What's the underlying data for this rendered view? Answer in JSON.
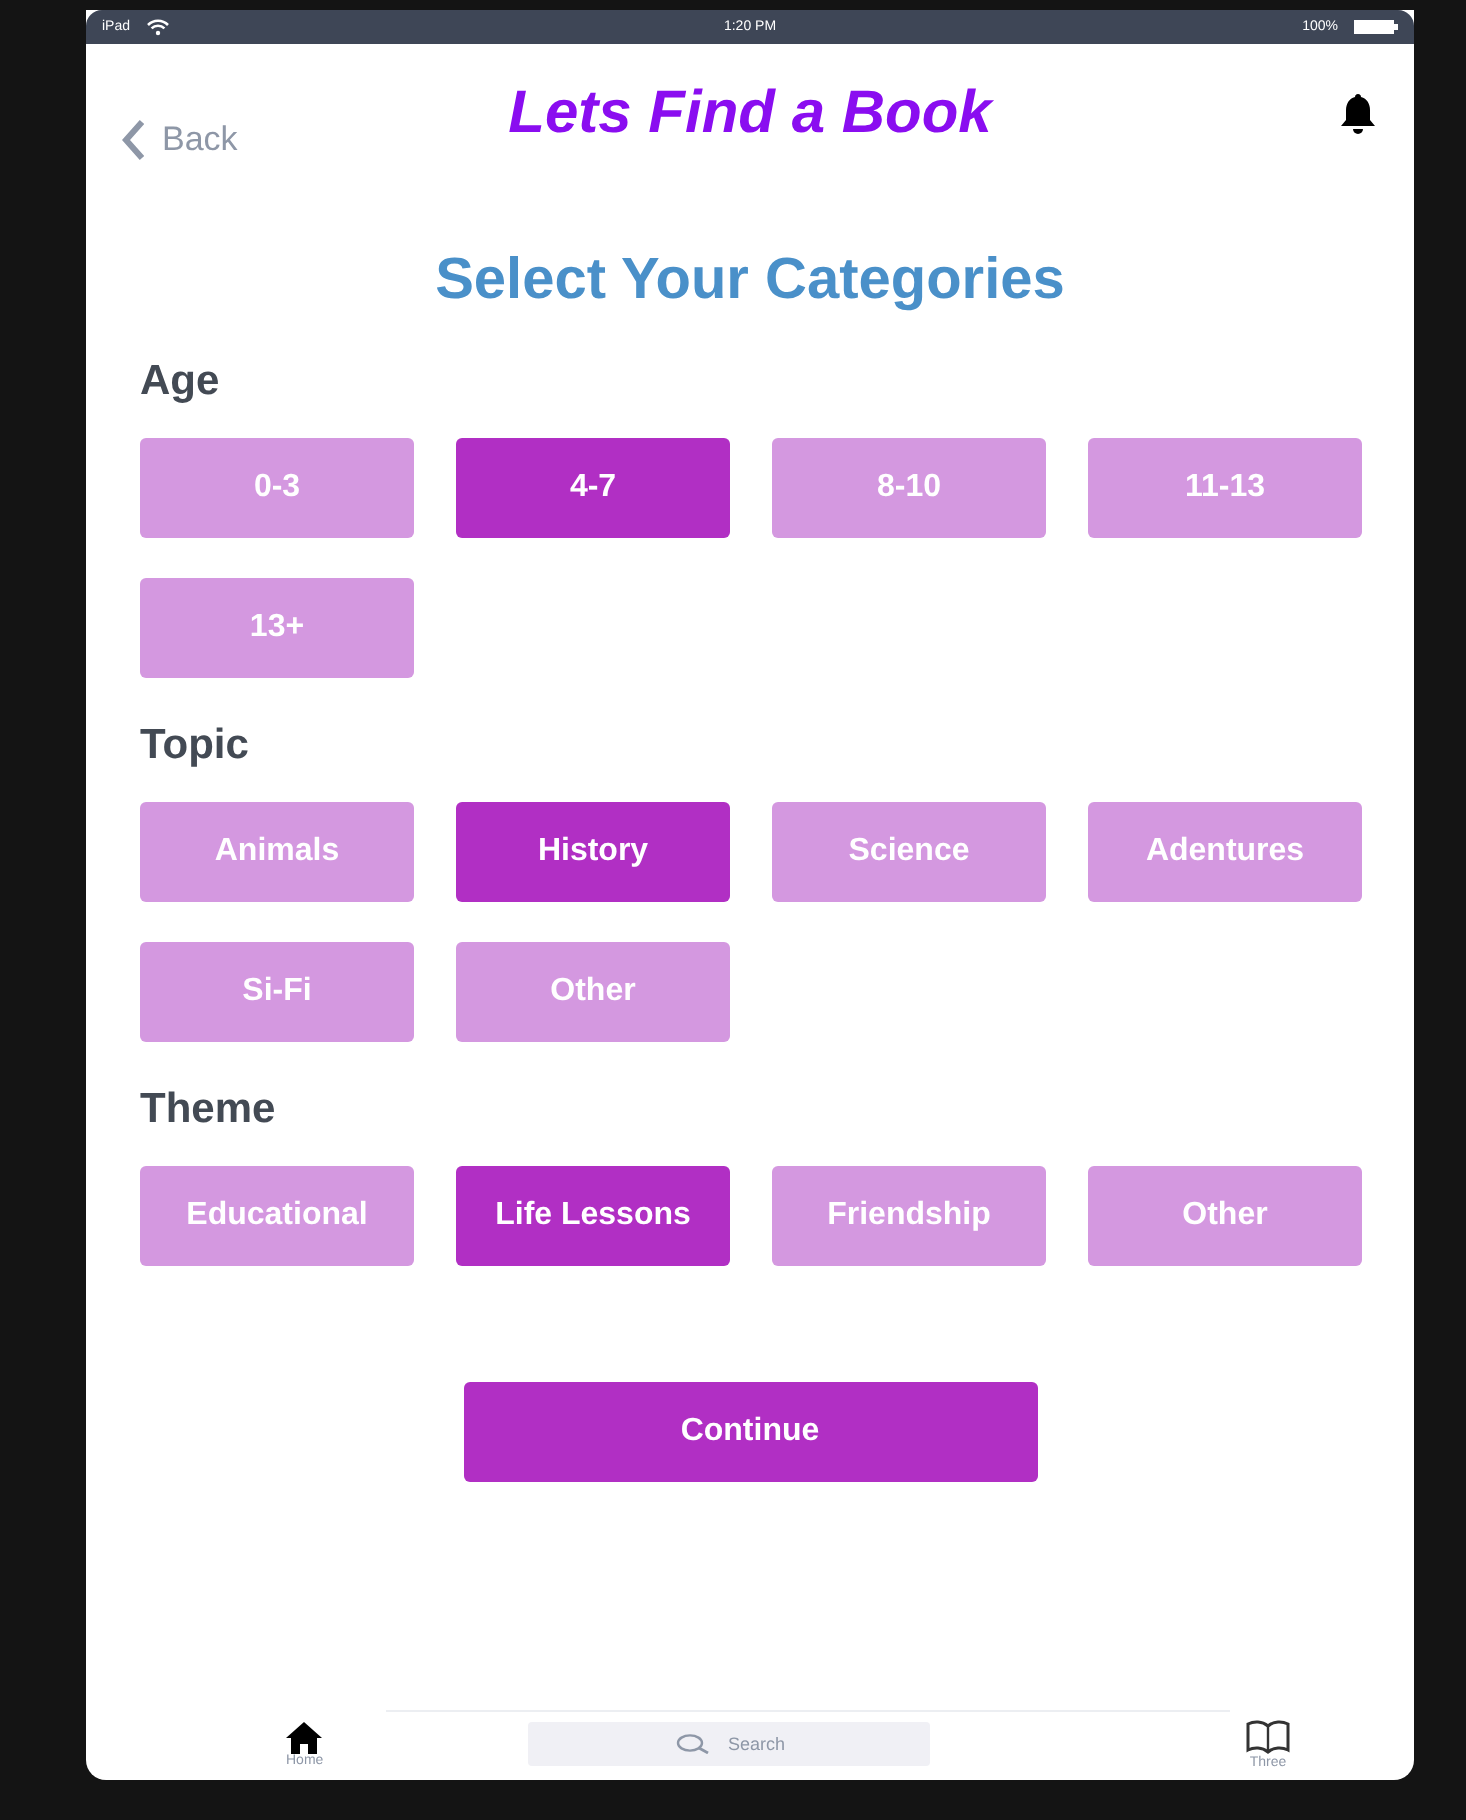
{
  "status_bar": {
    "device": "iPad",
    "time": "1:20 PM",
    "battery": "100%"
  },
  "nav": {
    "back": "Back",
    "title": "Lets Find a Book"
  },
  "heading": "Select Your Categories",
  "groups": [
    {
      "label": "Age",
      "options": [
        {
          "label": "0-3",
          "selected": false
        },
        {
          "label": "4-7",
          "selected": true
        },
        {
          "label": "8-10",
          "selected": false
        },
        {
          "label": "11-13",
          "selected": false
        },
        {
          "label": "13+",
          "selected": false
        }
      ]
    },
    {
      "label": "Topic",
      "options": [
        {
          "label": "Animals",
          "selected": false
        },
        {
          "label": "History",
          "selected": true
        },
        {
          "label": "Science",
          "selected": false
        },
        {
          "label": "Adentures",
          "selected": false
        },
        {
          "label": "Si-Fi",
          "selected": false
        },
        {
          "label": "Other",
          "selected": false
        }
      ]
    },
    {
      "label": "Theme",
      "options": [
        {
          "label": "Educational",
          "selected": false
        },
        {
          "label": "Life Lessons",
          "selected": true
        },
        {
          "label": "Friendship",
          "selected": false
        },
        {
          "label": "Other",
          "selected": false
        }
      ]
    }
  ],
  "continue": "Continue",
  "tab_bar": {
    "home": "Home",
    "search_placeholder": "Search",
    "third": "Three"
  }
}
